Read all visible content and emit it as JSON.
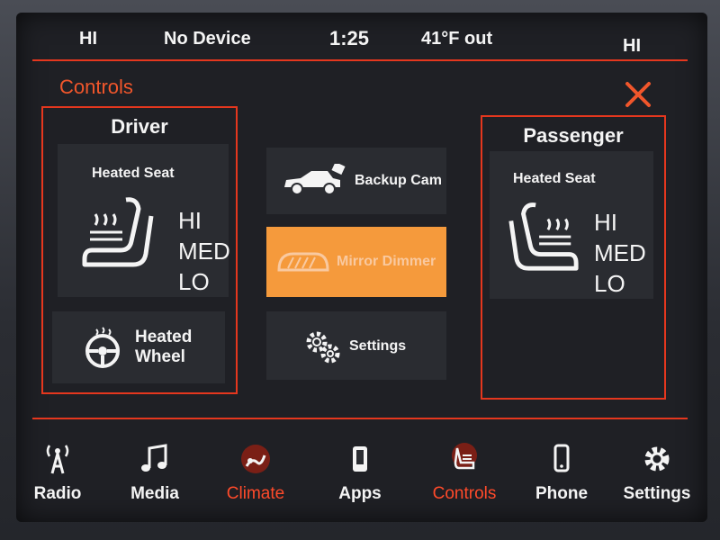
{
  "status": {
    "left_temp": "HI",
    "device": "No Device",
    "time": "1:25",
    "outside": "41°F out",
    "right_temp": "HI"
  },
  "section_title": "Controls",
  "driver": {
    "title": "Driver",
    "heated_seat_label": "Heated Seat",
    "levels": [
      "HI",
      "MED",
      "LO"
    ],
    "heated_wheel_label": [
      "Heated",
      "Wheel"
    ]
  },
  "center_buttons": [
    {
      "label": "Backup Cam",
      "icon": "car-camera-icon",
      "active": false
    },
    {
      "label": "Mirror Dimmer",
      "icon": "mirror-icon",
      "active": true
    },
    {
      "label": "Settings",
      "icon": "gears-icon",
      "active": false
    }
  ],
  "passenger": {
    "title": "Passenger",
    "heated_seat_label": "Heated Seat",
    "levels": [
      "HI",
      "MED",
      "LO"
    ]
  },
  "nav": [
    {
      "label": "Radio",
      "icon": "radio-tower-icon"
    },
    {
      "label": "Media",
      "icon": "music-note-icon"
    },
    {
      "label": "Climate",
      "icon": "climate-icon"
    },
    {
      "label": "Apps",
      "icon": "apps-icon"
    },
    {
      "label": "Controls",
      "icon": "controls-icon"
    },
    {
      "label": "Phone",
      "icon": "phone-icon"
    },
    {
      "label": "Settings",
      "icon": "gear-icon"
    }
  ],
  "colors": {
    "accent": "#e5371e",
    "active": "#f59a3c",
    "highlight_text": "#ff4a2a"
  }
}
